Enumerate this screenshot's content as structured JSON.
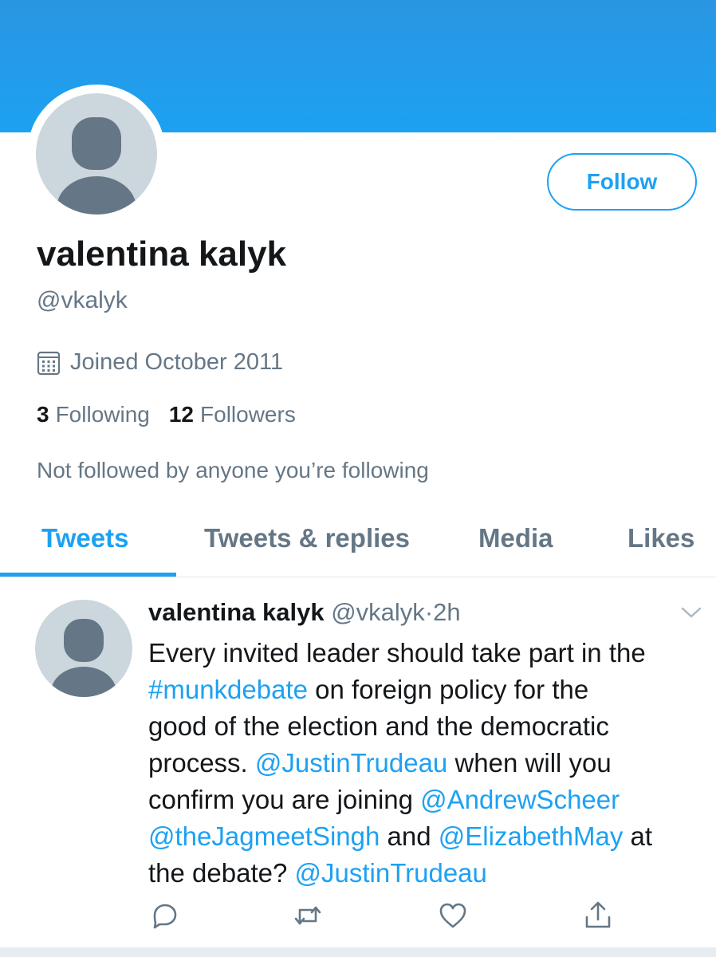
{
  "profile": {
    "name": "valentina kalyk",
    "handle": "@vkalyk",
    "joined": "Joined October 2011",
    "following_count": "3",
    "following_label": "Following",
    "followers_count": "12",
    "followers_label": "Followers",
    "not_followed": "Not followed by anyone you’re following",
    "follow_button": "Follow"
  },
  "tabs": [
    {
      "label": "Tweets",
      "active": true
    },
    {
      "label": "Tweets & replies",
      "active": false
    },
    {
      "label": "Media",
      "active": false
    },
    {
      "label": "Likes",
      "active": false
    }
  ],
  "tweet": {
    "name": "valentina kalyk",
    "handle": "@vkalyk",
    "dot": "·",
    "time": "2h",
    "lines": [
      [
        {
          "t": "Every invited leader should take part in the",
          "link": false
        }
      ],
      [
        {
          "t": "#munkdebate",
          "link": true
        },
        {
          "t": " on foreign policy for the",
          "link": false
        }
      ],
      [
        {
          "t": "good of the election and the democratic",
          "link": false
        }
      ],
      [
        {
          "t": "process. ",
          "link": false
        },
        {
          "t": "@JustinTrudeau",
          "link": true
        },
        {
          "t": " when will you",
          "link": false
        }
      ],
      [
        {
          "t": "confirm you are joining ",
          "link": false
        },
        {
          "t": "@AndrewScheer",
          "link": true
        }
      ],
      [
        {
          "t": "@theJagmeetSingh",
          "link": true
        },
        {
          "t": " and ",
          "link": false
        },
        {
          "t": "@ElizabethMay",
          "link": true
        },
        {
          "t": " at",
          "link": false
        }
      ],
      [
        {
          "t": "the debate? ",
          "link": false
        },
        {
          "t": "@JustinTrudeau",
          "link": true
        }
      ]
    ]
  },
  "icons": {
    "calendar": "calendar-icon",
    "chevron": "chevron-down-icon",
    "reply": "reply-icon",
    "retweet": "retweet-icon",
    "like": "heart-icon",
    "share": "share-icon"
  },
  "colors": {
    "accent": "#1da1f2",
    "secondary_text": "#657786",
    "primary_text": "#14171a",
    "avatar_bg": "#ccd6dd"
  }
}
